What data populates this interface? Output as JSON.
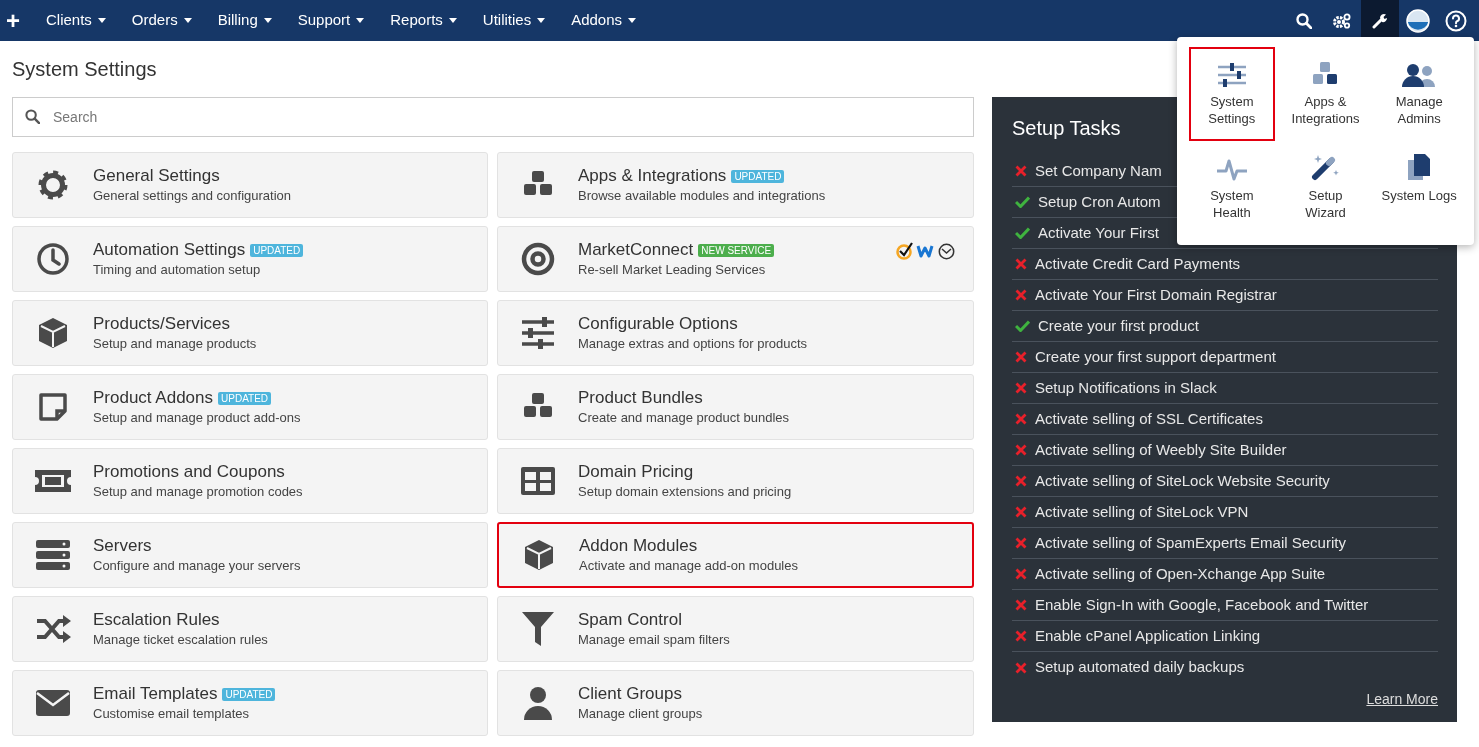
{
  "nav": {
    "add_symbol": "+",
    "menus": [
      {
        "label": "Clients"
      },
      {
        "label": "Orders"
      },
      {
        "label": "Billing"
      },
      {
        "label": "Support"
      },
      {
        "label": "Reports"
      },
      {
        "label": "Utilities"
      },
      {
        "label": "Addons"
      }
    ],
    "tools": [
      {
        "kind": "search",
        "selected": false
      },
      {
        "kind": "gears",
        "selected": false
      },
      {
        "kind": "wrench",
        "selected": true
      },
      {
        "kind": "avatar",
        "selected": false
      },
      {
        "kind": "help",
        "selected": false
      }
    ]
  },
  "page_title": "System Settings",
  "search": {
    "placeholder": "Search"
  },
  "cards": [
    {
      "title": "General Settings",
      "description": "General settings and configuration",
      "highlighted": false
    },
    {
      "title": "Apps & Integrations",
      "badge": {
        "text": "UPDATED",
        "kind": "updated"
      },
      "description": "Browse available modules and integrations",
      "highlighted": false
    },
    {
      "title": "Automation Settings",
      "badge": {
        "text": "UPDATED",
        "kind": "updated"
      },
      "description": "Timing and automation setup",
      "highlighted": false
    },
    {
      "title": "MarketConnect",
      "badge": {
        "text": "NEW SERVICE",
        "kind": "new"
      },
      "description": "Re-sell Market Leading Services",
      "highlighted": false,
      "partner_logos": true
    },
    {
      "title": "Products/Services",
      "description": "Setup and manage products",
      "highlighted": false
    },
    {
      "title": "Configurable Options",
      "description": "Manage extras and options for products",
      "highlighted": false
    },
    {
      "title": "Product Addons",
      "badge": {
        "text": "UPDATED",
        "kind": "updated"
      },
      "description": "Setup and manage product add-ons",
      "highlighted": false
    },
    {
      "title": "Product Bundles",
      "description": "Create and manage product bundles",
      "highlighted": false
    },
    {
      "title": "Promotions and Coupons",
      "description": "Setup and manage promotion codes",
      "highlighted": false
    },
    {
      "title": "Domain Pricing",
      "description": "Setup domain extensions and pricing",
      "highlighted": false
    },
    {
      "title": "Servers",
      "description": "Configure and manage your servers",
      "highlighted": false
    },
    {
      "title": "Addon Modules",
      "description": "Activate and manage add-on modules",
      "highlighted": true
    },
    {
      "title": "Escalation Rules",
      "description": "Manage ticket escalation rules",
      "highlighted": false
    },
    {
      "title": "Spam Control",
      "description": "Manage email spam filters",
      "highlighted": false
    },
    {
      "title": "Email Templates",
      "badge": {
        "text": "UPDATED",
        "kind": "updated"
      },
      "description": "Customise email templates",
      "highlighted": false
    },
    {
      "title": "Client Groups",
      "description": "Manage client groups",
      "highlighted": false
    }
  ],
  "setup_tasks": {
    "title": "Setup Tasks",
    "items": [
      {
        "label": "Set Company Nam",
        "done": false
      },
      {
        "label": "Setup Cron Autom",
        "done": true
      },
      {
        "label": "Activate Your First",
        "done": true
      },
      {
        "label": "Activate Credit Card Payments",
        "done": false
      },
      {
        "label": "Activate Your First Domain Registrar",
        "done": false
      },
      {
        "label": "Create your first product",
        "done": true
      },
      {
        "label": "Create your first support department",
        "done": false
      },
      {
        "label": "Setup Notifications in Slack",
        "done": false
      },
      {
        "label": "Activate selling of SSL Certificates",
        "done": false
      },
      {
        "label": "Activate selling of Weebly Site Builder",
        "done": false
      },
      {
        "label": "Activate selling of SiteLock Website Security",
        "done": false
      },
      {
        "label": "Activate selling of SiteLock VPN",
        "done": false
      },
      {
        "label": "Activate selling of SpamExperts Email Security",
        "done": false
      },
      {
        "label": "Activate selling of Open-Xchange App Suite",
        "done": false
      },
      {
        "label": "Enable Sign-In with Google, Facebook and Twitter",
        "done": false
      },
      {
        "label": "Enable cPanel Application Linking",
        "done": false
      },
      {
        "label": "Setup automated daily backups",
        "done": false
      }
    ],
    "link": "Learn More"
  },
  "config_menu": {
    "items": [
      {
        "label": "System Settings",
        "highlighted": true
      },
      {
        "label": "Apps & Integrations",
        "highlighted": false
      },
      {
        "label": "Manage Admins",
        "highlighted": false
      },
      {
        "label": "System Health",
        "highlighted": false
      },
      {
        "label": "Setup Wizard",
        "highlighted": false
      },
      {
        "label": "System Logs",
        "highlighted": false
      }
    ]
  }
}
